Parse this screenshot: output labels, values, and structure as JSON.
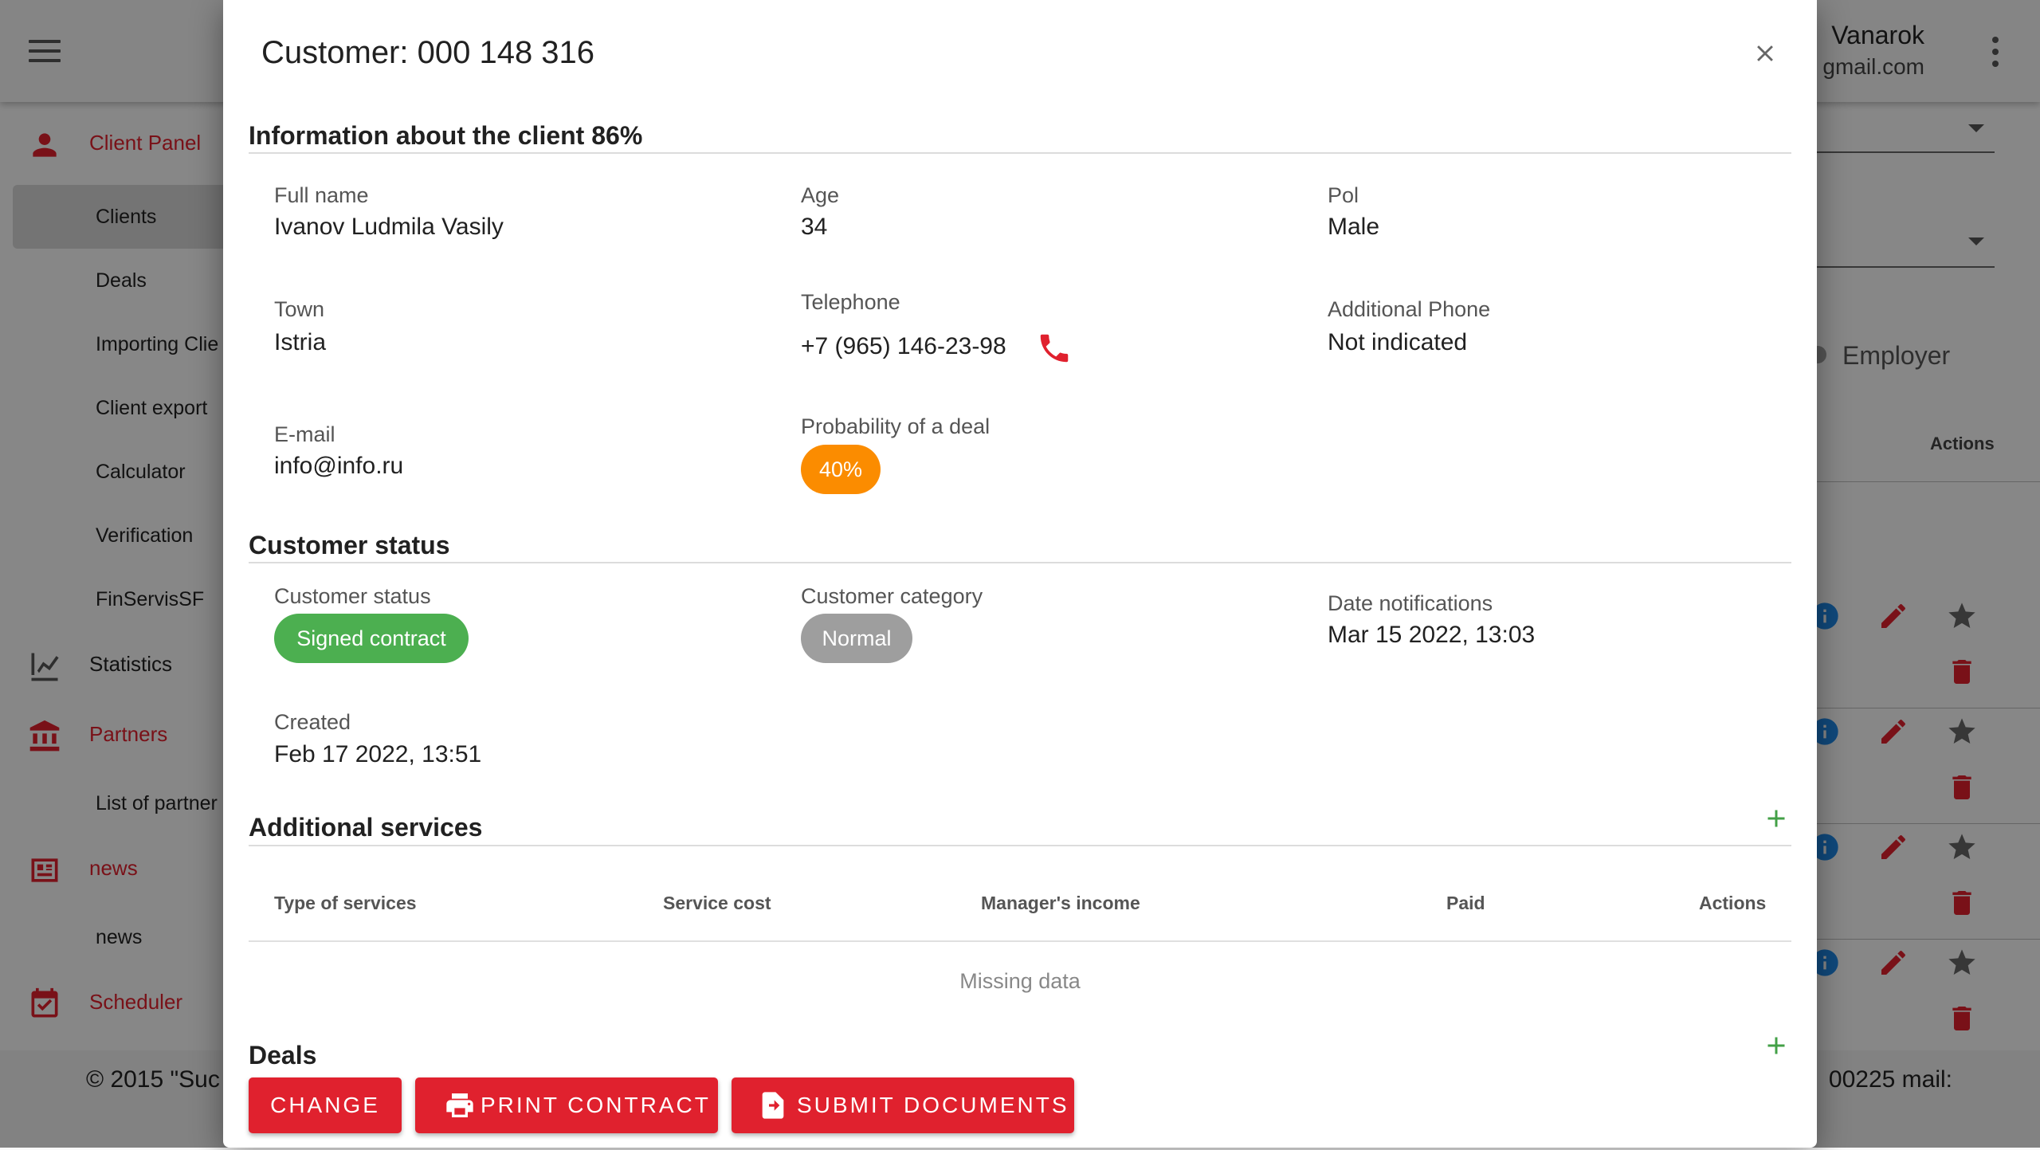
{
  "app": {
    "user": {
      "name": "Vanarok",
      "email": "gmail.com"
    },
    "footer": {
      "left": "© 2015 \"Suc",
      "right": "00225 mail:"
    },
    "sidebar": {
      "sections": [
        {
          "label": "Client Panel",
          "icon": "person-icon"
        },
        {
          "label": "Statistics",
          "icon": "chart-line-icon"
        },
        {
          "label": "Partners",
          "icon": "bank-icon"
        },
        {
          "label": "news",
          "icon": "newspaper-icon"
        },
        {
          "label": "Scheduler",
          "icon": "calendar-check-icon"
        }
      ],
      "items": [
        "Clients",
        "Deals",
        "Importing Clie",
        "Client export",
        "Calculator",
        "Verification",
        "FinServisSF",
        "List of partner",
        "news"
      ]
    },
    "right_panel": {
      "employer_label": "Employer",
      "actions_header": "Actions"
    }
  },
  "modal": {
    "title": "Customer: 000 148 316",
    "info_section": {
      "title": "Information about the client 86%",
      "fields": {
        "full_name": {
          "label": "Full name",
          "value": "Ivanov Ludmila Vasily"
        },
        "age": {
          "label": "Age",
          "value": "34"
        },
        "pol": {
          "label": "Pol",
          "value": "Male"
        },
        "town": {
          "label": "Town",
          "value": "Istria"
        },
        "telephone": {
          "label": "Telephone",
          "value": "+7 (965) 146-23-98"
        },
        "additional_phone": {
          "label": "Additional Phone",
          "value": "Not indicated"
        },
        "email": {
          "label": "E-mail",
          "value": "info@info.ru"
        },
        "probability": {
          "label": "Probability of a deal",
          "value": "40%",
          "percent": 40
        }
      }
    },
    "status_section": {
      "title": "Customer status",
      "customer_status": {
        "label": "Customer status",
        "value": "Signed contract",
        "color": "#4caf50"
      },
      "customer_category": {
        "label": "Customer category",
        "value": "Normal",
        "color": "#9e9e9e"
      },
      "date_notifications": {
        "label": "Date notifications",
        "value": "Mar 15 2022, 13:03"
      },
      "created": {
        "label": "Created",
        "value": "Feb 17 2022, 13:51"
      }
    },
    "services_section": {
      "title": "Additional services",
      "columns": [
        "Type of services",
        "Service cost",
        "Manager's income",
        "Paid",
        "Actions"
      ],
      "empty_text": "Missing data"
    },
    "deals_section": {
      "title": "Deals"
    },
    "buttons": {
      "change": "Change",
      "print": "Print contract",
      "submit": "Submit documents"
    },
    "colors": {
      "accent": "#e0212e",
      "add": "#43a047",
      "probability_chip": "#fb8c00"
    }
  }
}
